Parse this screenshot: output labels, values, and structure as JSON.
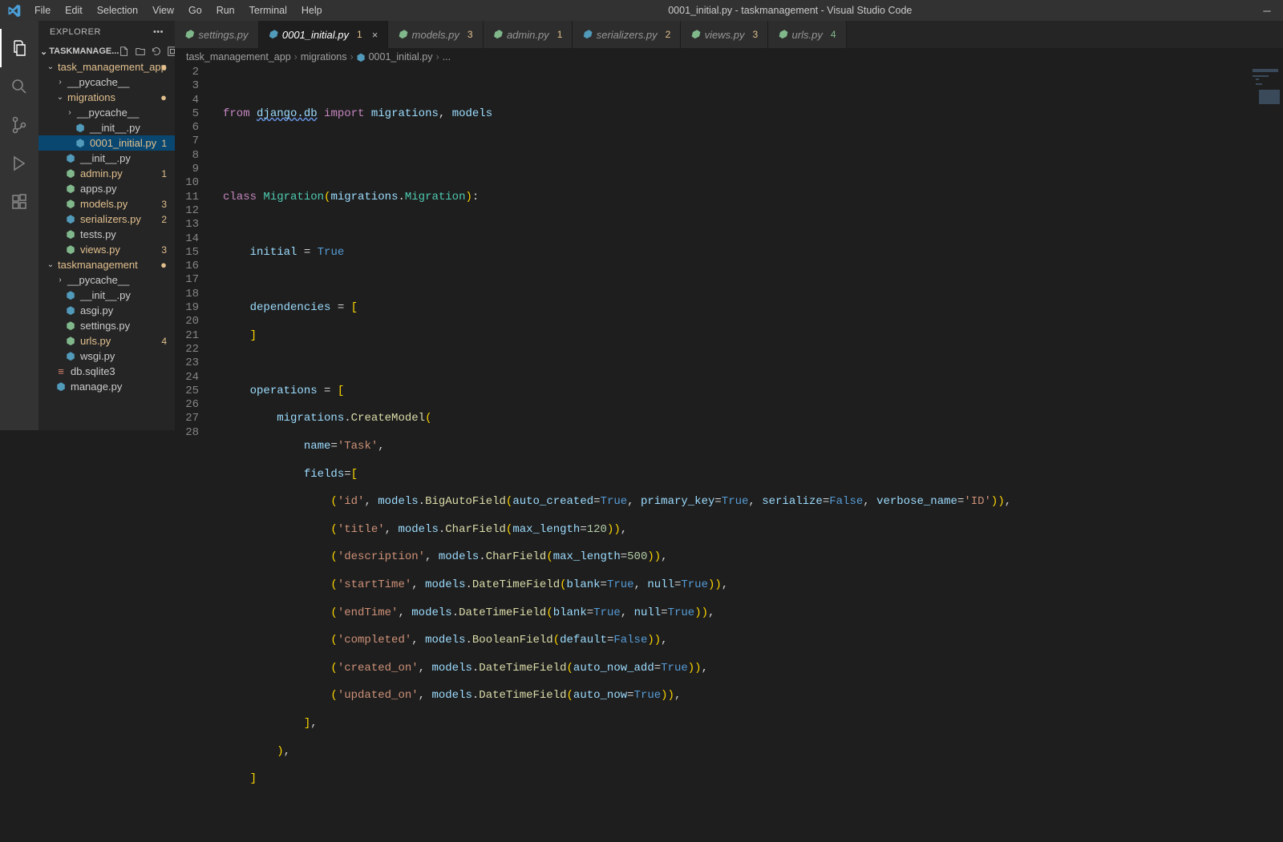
{
  "window_title": "0001_initial.py - taskmanagement - Visual Studio Code",
  "menu": [
    "File",
    "Edit",
    "Selection",
    "View",
    "Go",
    "Run",
    "Terminal",
    "Help"
  ],
  "sidebar_title": "EXPLORER",
  "project_name": "TASKMANAGE...",
  "tree": {
    "app": "task_management_app",
    "nodes": {
      "pycache1": "__pycache__",
      "migrations": "migrations",
      "pycache2": "__pycache__",
      "init1": "__init__.py",
      "file0001": "0001_initial.py",
      "init2": "__init__.py",
      "admin": "admin.py",
      "admin_b": "1",
      "apps": "apps.py",
      "models": "models.py",
      "models_b": "3",
      "serializers": "serializers.py",
      "serializers_b": "2",
      "tests": "tests.py",
      "views": "views.py",
      "views_b": "3",
      "taskmanagement": "taskmanagement",
      "pycache3": "__pycache__",
      "init3": "__init__.py",
      "asgi": "asgi.py",
      "settings": "settings.py",
      "urls": "urls.py",
      "urls_b": "4",
      "wsgi": "wsgi.py",
      "db": "db.sqlite3",
      "manage": "manage.py"
    }
  },
  "tabs": [
    {
      "name": "settings.py",
      "badge": ""
    },
    {
      "name": "0001_initial.py",
      "badge": "1",
      "active": true
    },
    {
      "name": "models.py",
      "badge": "3"
    },
    {
      "name": "admin.py",
      "badge": "1"
    },
    {
      "name": "serializers.py",
      "badge": "2"
    },
    {
      "name": "views.py",
      "badge": "3"
    },
    {
      "name": "urls.py",
      "badge": "4",
      "green": true
    }
  ],
  "breadcrumb": {
    "a": "task_management_app",
    "b": "migrations",
    "c": "0001_initial.py",
    "d": "..."
  },
  "line_start": 2,
  "line_end": 28
}
